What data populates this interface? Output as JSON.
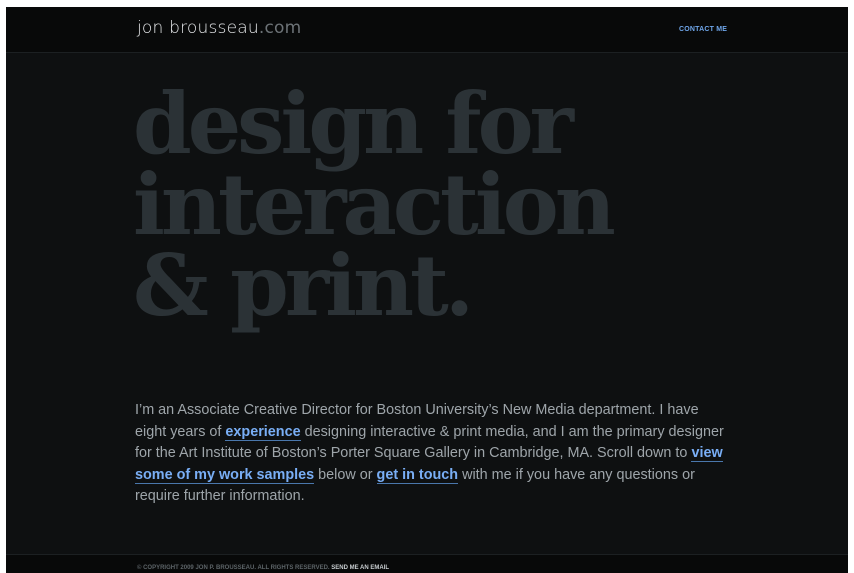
{
  "header": {
    "logo_main": "jon brousseau",
    "logo_tld": ".com",
    "contact_label": "CONTACT ME"
  },
  "hero": {
    "lines": [
      "design for",
      "interaction",
      "& print."
    ]
  },
  "intro": {
    "text_1": "I’m an Associate Creative Director for Boston University’s New Media department. I have eight years of ",
    "link_experience": "experience",
    "text_2": " designing interactive & print media, and I am the primary designer for the Art Institute of Boston’s Porter Square Gallery in Cambridge, MA. Scroll down to ",
    "link_work": "view some of my work samples",
    "text_3": " below or ",
    "link_contact": "get in touch",
    "text_4": " with me if you have any questions or require further information."
  },
  "footer": {
    "copyright": "© COPYRIGHT 2009 JON P. BROUSSEAU. ALL RIGHTS RESERVED. ",
    "email_link": "SEND ME AN EMAIL"
  },
  "colors": {
    "background": "#0e1011",
    "bar": "#080909",
    "headline": "#2b3236",
    "body_text": "#9ea5aa",
    "link": "#79aef5"
  }
}
